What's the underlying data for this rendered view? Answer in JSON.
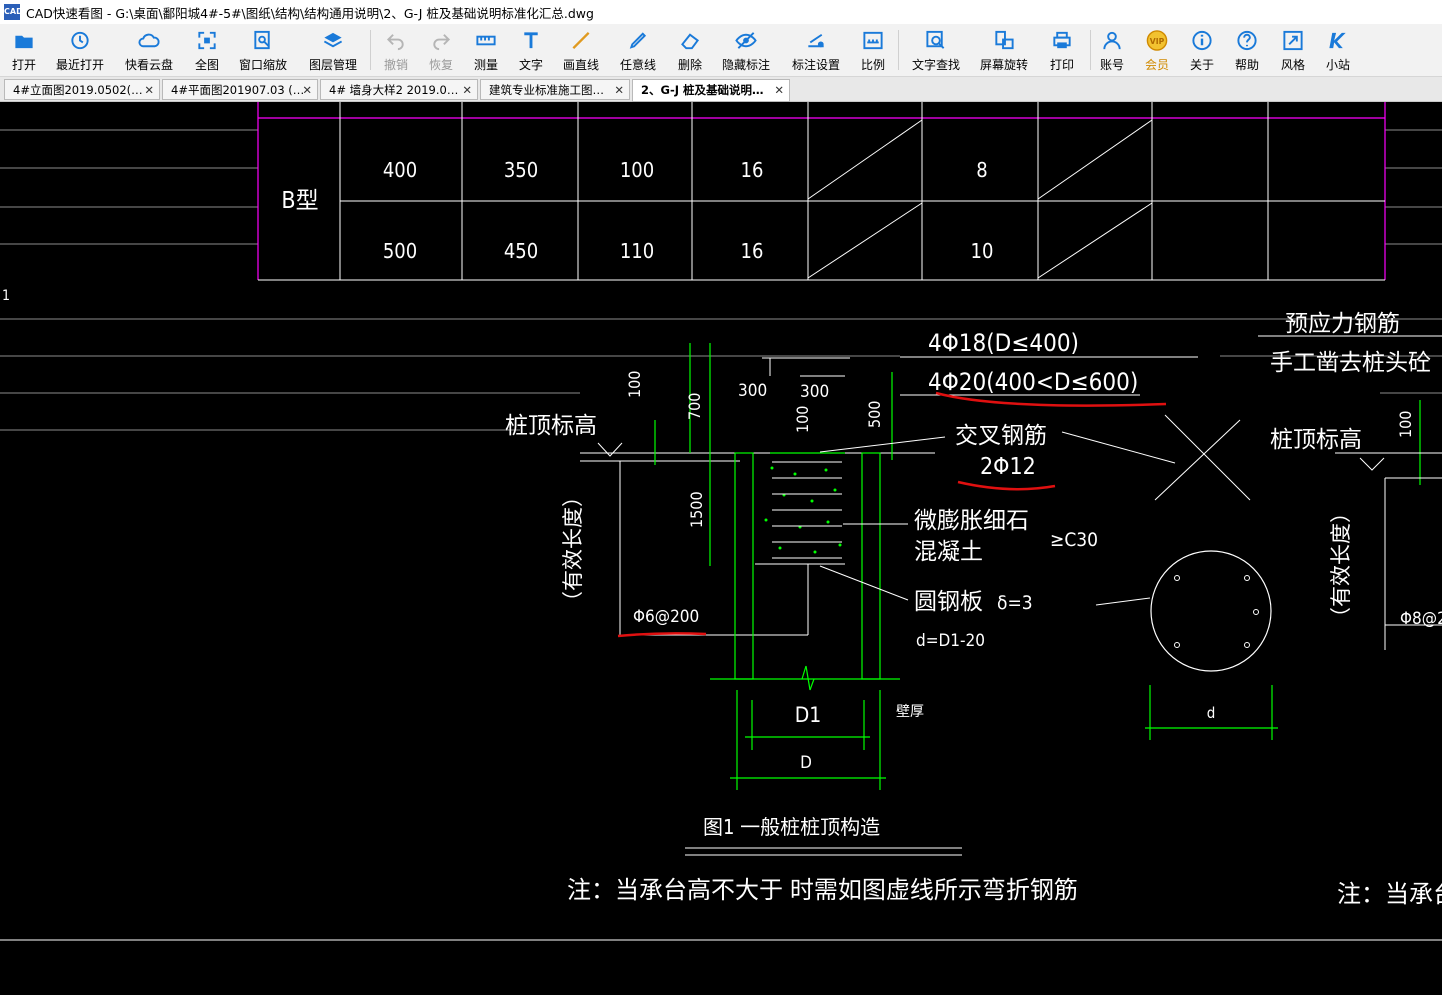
{
  "window": {
    "app_icon": "CAD",
    "title": "CAD快速看图 - G:\\桌面\\鄱阳城4#-5#\\图纸\\结构\\结构通用说明\\2、G-J 桩及基础说明标准化汇总.dwg"
  },
  "toolbar": {
    "items": [
      {
        "label": "打开",
        "icon": "open-folder-icon"
      },
      {
        "label": "最近打开",
        "icon": "recent-clock-icon"
      },
      {
        "label": "快看云盘",
        "icon": "cloud-icon"
      },
      {
        "label": "全图",
        "icon": "fullview-icon"
      },
      {
        "label": "窗口缩放",
        "icon": "zoom-window-icon"
      },
      {
        "label": "图层管理",
        "icon": "layers-icon"
      },
      {
        "label": "撤销",
        "icon": "undo-icon"
      },
      {
        "label": "恢复",
        "icon": "redo-icon"
      },
      {
        "label": "测量",
        "icon": "measure-icon"
      },
      {
        "label": "文字",
        "icon": "text-icon"
      },
      {
        "label": "画直线",
        "icon": "line-icon"
      },
      {
        "label": "任意线",
        "icon": "pen-icon"
      },
      {
        "label": "删除",
        "icon": "eraser-icon"
      },
      {
        "label": "隐藏标注",
        "icon": "eye-hide-icon"
      },
      {
        "label": "标注设置",
        "icon": "dimension-settings-icon"
      },
      {
        "label": "比例",
        "icon": "scale-icon"
      },
      {
        "label": "文字查找",
        "icon": "text-search-icon"
      },
      {
        "label": "屏幕旋转",
        "icon": "rotate-screen-icon"
      },
      {
        "label": "打印",
        "icon": "printer-icon"
      },
      {
        "label": "账号",
        "icon": "user-icon"
      },
      {
        "label": "会员",
        "icon": "vip-icon"
      },
      {
        "label": "关于",
        "icon": "info-icon"
      },
      {
        "label": "帮助",
        "icon": "help-icon"
      },
      {
        "label": "风格",
        "icon": "style-icon"
      },
      {
        "label": "小站",
        "icon": "site-logo-icon"
      }
    ],
    "vip_badge": "VIP"
  },
  "tabs": [
    {
      "label": "4#立面图2019.0502(…",
      "active": false
    },
    {
      "label": "4#平面图201907.03 (…",
      "active": false
    },
    {
      "label": "4# 墙身大样2 2019.0…",
      "active": false
    },
    {
      "label": "建筑专业标准施工图…",
      "active": false
    },
    {
      "label": "2、G-J 桩及基础说明…",
      "active": true
    }
  ],
  "drawing": {
    "table": {
      "type_label": "B型",
      "rows": [
        [
          "400",
          "350",
          "100",
          "16",
          "8"
        ],
        [
          "500",
          "450",
          "110",
          "16",
          "10"
        ]
      ]
    },
    "marker": "1",
    "rebar_1": "4Φ18(D≤400)",
    "rebar_2": "4Φ20(400<D≤600)",
    "prestressed": "预应力钢筋",
    "cut_off": "手工凿去桩头砼",
    "pile_top_left": "桩顶标高",
    "pile_top_right": "桩顶标高",
    "dims": {
      "d100a": "100",
      "d700": "700",
      "d300a": "300",
      "d300b": "300",
      "d100b": "100",
      "d500": "500",
      "d1500": "1500",
      "d100c": "100"
    },
    "cross_rebar": "交叉钢筋",
    "cross_rebar_spec": "2Φ12",
    "micro_expansion_1": "微膨胀细石",
    "micro_expansion_2": "混凝土",
    "concrete_grade": "≥C30",
    "steel_plate": "圆钢板",
    "plate_thickness": "δ=3",
    "d_formula": "d=D1-20",
    "effective_length_left": "（有效长度）",
    "effective_length_right": "（有效长度）",
    "stirrup_left": "Φ6@200",
    "stirrup_right": "Φ8@2",
    "dim_D1": "D1",
    "dim_D": "D",
    "wall_thickness": "壁厚",
    "dim_d": "d",
    "figure_caption": "图1 一般桩桩顶构造",
    "note_left": "注：当承台高不大于      时需如图虚线所示弯折钢筋",
    "note_right": "注：当承台"
  },
  "colors": {
    "cad_bg": "#000000",
    "cad_white": "#ffffff",
    "cad_magenta": "#ff00ff",
    "cad_green": "#00ff00",
    "cad_grid": "#8c8c8c",
    "annotation_red": "#e01010",
    "accent_blue": "#1a7ad9",
    "vip_gold": "#d08a00"
  }
}
